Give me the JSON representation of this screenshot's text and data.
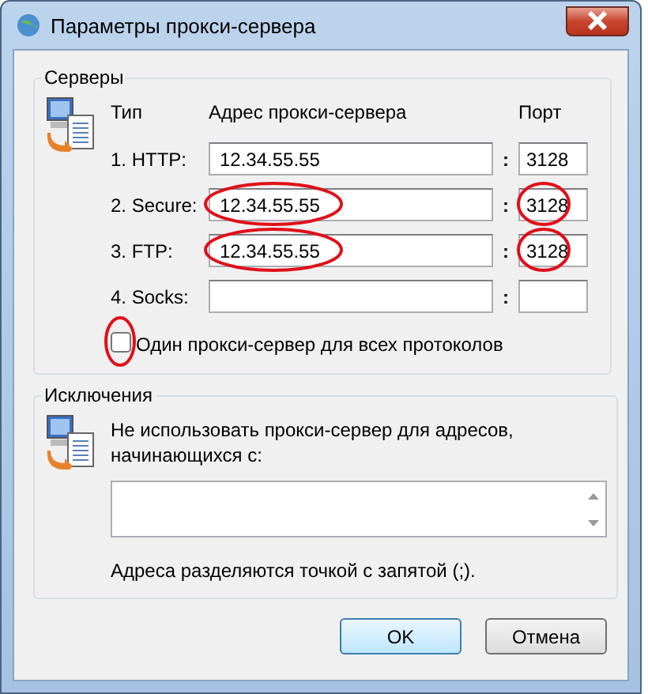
{
  "window": {
    "title": "Параметры прокси-сервера"
  },
  "servers": {
    "title": "Серверы",
    "columns": {
      "type": "Тип",
      "address": "Адрес прокси-сервера",
      "port": "Порт"
    },
    "rows": [
      {
        "label": "1. HTTP:",
        "address": "12.34.55.55",
        "separator": ":",
        "port": "3128",
        "address_circled": false,
        "port_circled": false
      },
      {
        "label": "2. Secure:",
        "address": "12.34.55.55",
        "separator": ":",
        "port": "3128",
        "address_circled": true,
        "port_circled": true
      },
      {
        "label": "3. FTP:",
        "address": "12.34.55.55",
        "separator": ":",
        "port": "3128",
        "address_circled": true,
        "port_circled": true
      },
      {
        "label": "4. Socks:",
        "separator": ":",
        "address_circled": false,
        "port_circled": false
      }
    ],
    "same_proxy": {
      "label": "Один прокси-сервер для всех протоколов",
      "checked": false,
      "circled": true
    }
  },
  "exceptions": {
    "title": "Исключения",
    "description": "Не использовать прокси-сервер для адресов, начинающихся с:",
    "note": "Адреса разделяются точкой с запятой (;)."
  },
  "buttons": [
    {
      "label": "OK",
      "default": true
    },
    {
      "label": "Отмена",
      "default": false
    }
  ]
}
